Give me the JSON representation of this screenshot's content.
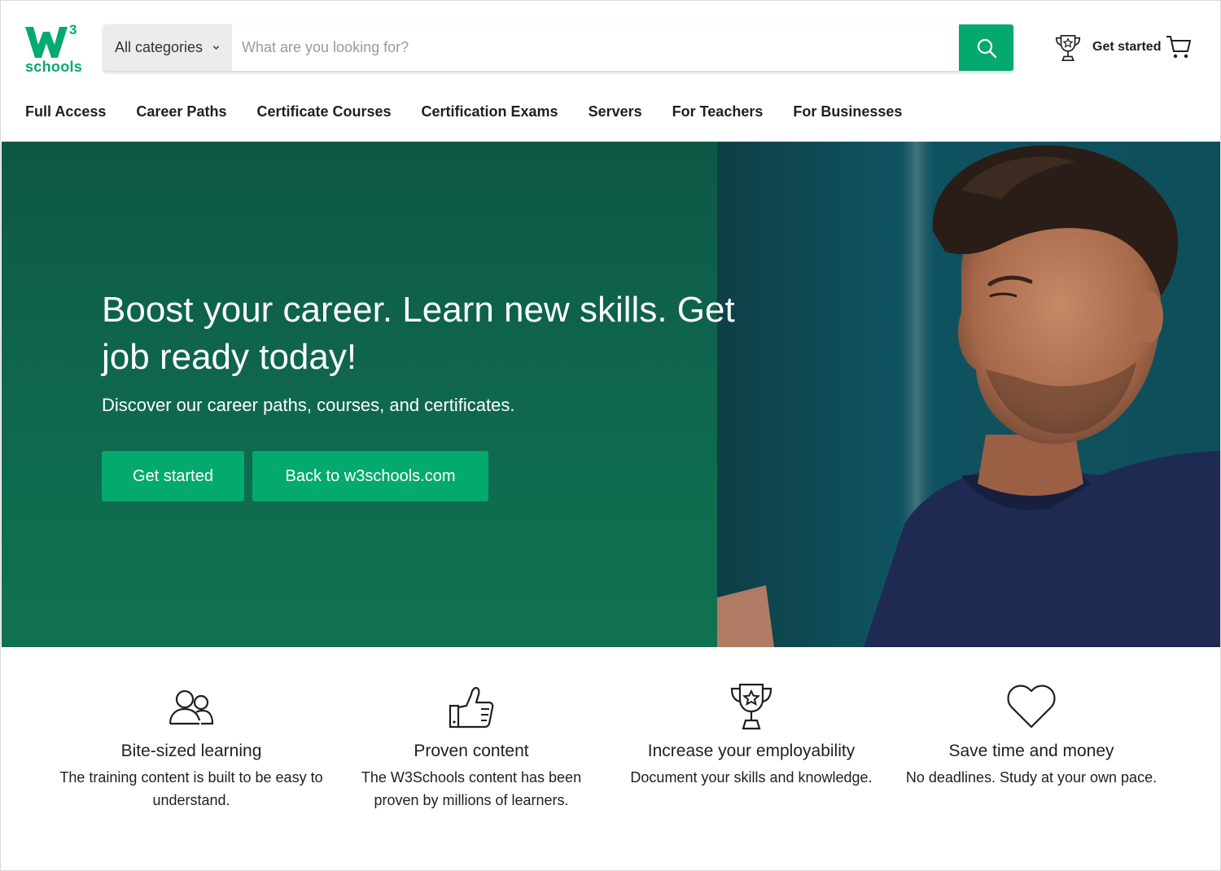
{
  "brand": {
    "name": "schools",
    "superscript": "3",
    "accent_color": "#04aa6d"
  },
  "search": {
    "category_label": "All categories",
    "placeholder": "What are you looking for?",
    "value": ""
  },
  "header": {
    "get_started_label": "Get started"
  },
  "nav": {
    "items": [
      {
        "label": "Full Access"
      },
      {
        "label": "Career Paths"
      },
      {
        "label": "Certificate Courses"
      },
      {
        "label": "Certification Exams"
      },
      {
        "label": "Servers"
      },
      {
        "label": "For Teachers"
      },
      {
        "label": "For Businesses"
      }
    ]
  },
  "hero": {
    "title": "Boost your career. Learn new skills. Get job ready today!",
    "subtitle": "Discover our career paths, courses, and certificates.",
    "primary_button": "Get started",
    "secondary_button": "Back to w3schools.com",
    "background_color": "#0f6a4f"
  },
  "features": [
    {
      "icon": "people-icon",
      "title": "Bite-sized learning",
      "description": "The training content is built to be easy to understand."
    },
    {
      "icon": "thumbs-up-icon",
      "title": "Proven content",
      "description": "The W3Schools content has been proven by millions of learners."
    },
    {
      "icon": "trophy-icon",
      "title": "Increase your employability",
      "description": "Document your skills and knowledge."
    },
    {
      "icon": "heart-icon",
      "title": "Save time and money",
      "description": "No deadlines. Study at your own pace."
    }
  ]
}
